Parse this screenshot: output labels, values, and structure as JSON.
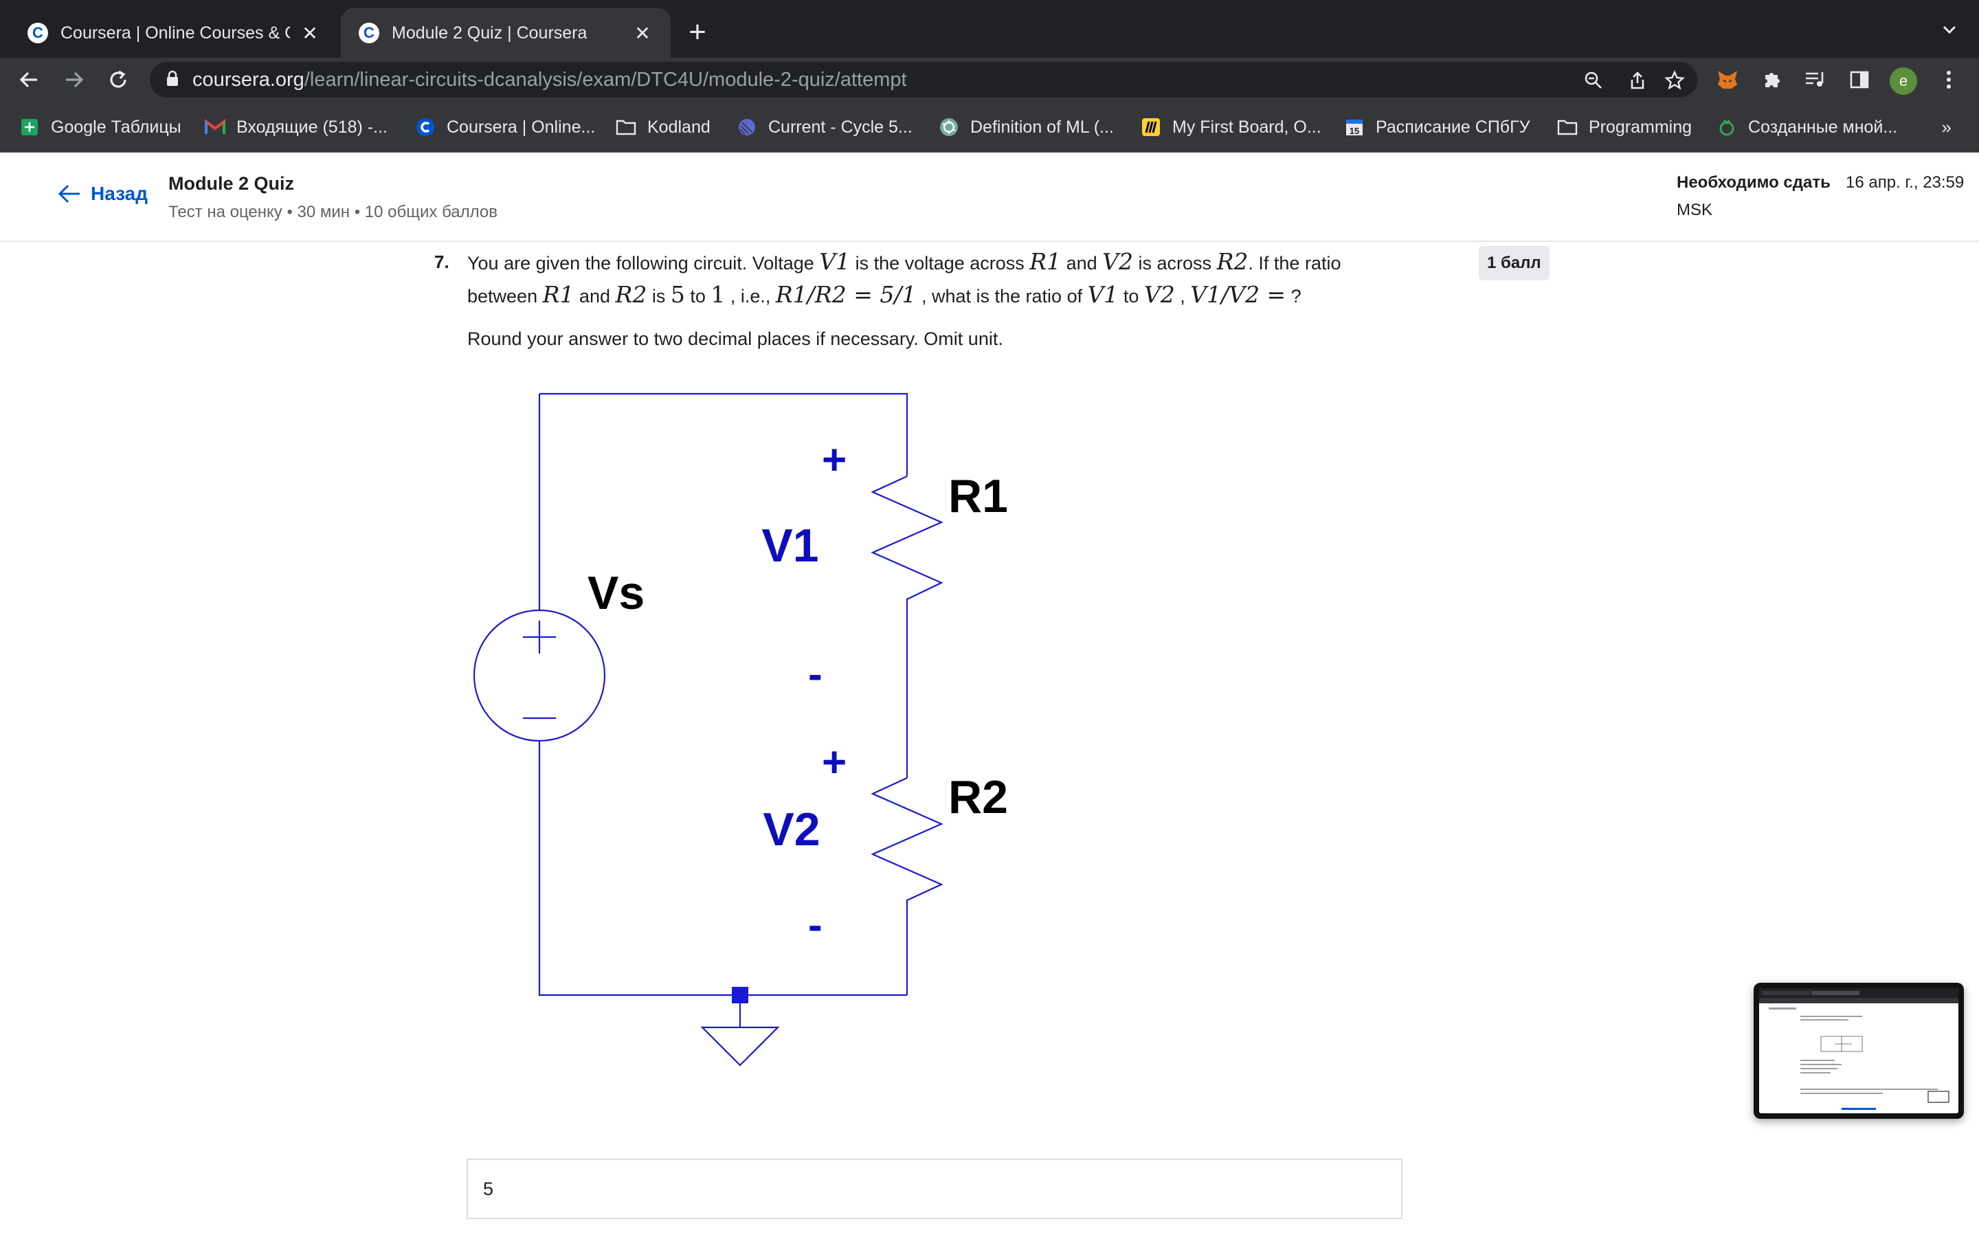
{
  "browser": {
    "tabs": [
      {
        "title": "Coursera | Online Courses & Credentials From Top Educators",
        "active": false
      },
      {
        "title": "Module 2 Quiz | Coursera",
        "active": true
      }
    ],
    "url_host": "coursera.org",
    "url_path": "/learn/linear-circuits-dcanalysis/exam/DTC4U/module-2-quiz/attempt",
    "profile_initial": "e",
    "bookmarks": [
      {
        "label": "Google Таблицы",
        "icon": "sheets-icon"
      },
      {
        "label": "Входящие (518) -...",
        "icon": "gmail-icon"
      },
      {
        "label": "Coursera | Online...",
        "icon": "coursera-icon"
      },
      {
        "label": "Kodland",
        "icon": "folder-icon"
      },
      {
        "label": "Current - Cycle 5...",
        "icon": "linear-icon"
      },
      {
        "label": "Definition of ML (...",
        "icon": "openai-icon"
      },
      {
        "label": "My First Board, O...",
        "icon": "miro-icon"
      },
      {
        "label": "Расписание СПбГУ",
        "icon": "calendar-icon"
      },
      {
        "label": "Programming",
        "icon": "folder-icon"
      },
      {
        "label": "Созданные мной...",
        "icon": "money-icon"
      }
    ],
    "bookmarks_overflow": "»"
  },
  "header": {
    "back_label": "Назад",
    "quiz_title": "Module 2 Quiz",
    "quiz_subtitle": "Тест на оценку • 30 мин • 10 общих баллов",
    "due_label": "Необходимо сдать",
    "due_date": "16 апр. г., 23:59",
    "due_tz": "MSK"
  },
  "question": {
    "number": "7.",
    "points": "1 балл",
    "text_parts": {
      "p1": "You are given the following circuit. Voltage ",
      "v1": "V1",
      "p2": " is the voltage across ",
      "r1": "R1",
      "p3": " and ",
      "v2": "V2",
      "p4": " is across ",
      "r2": "R2",
      "p5": ". If the ratio between ",
      "r1b": "R1",
      "p6": " and ",
      "r2b": "R2",
      "p7": " is ",
      "five": "5",
      "p8": " to ",
      "one": "1",
      "p9": " , i.e., ",
      "ratio_expr": "R1/R2 = 5/1",
      "p10": " , what is the ratio of ",
      "v1b": "V1",
      "p11": " to ",
      "v2b": "V2",
      "p12": " , ",
      "ask_expr": "V1/V2 =",
      "p13": " ?"
    },
    "instruction": "Round your answer to two decimal places if necessary. Omit unit.",
    "answer_value": "5"
  },
  "circuit": {
    "source_label": "Vs",
    "r1_label": "R1",
    "r2_label": "R2",
    "v1_label": "V1",
    "v2_label": "V2",
    "plus": "+",
    "minus": "-",
    "wire_color": "#1a1ad6",
    "label_color": "#0d0dbf"
  },
  "colors": {
    "accent": "#0056d2",
    "chrome_dark": "#202124",
    "chrome_toolbar": "#35363a"
  }
}
